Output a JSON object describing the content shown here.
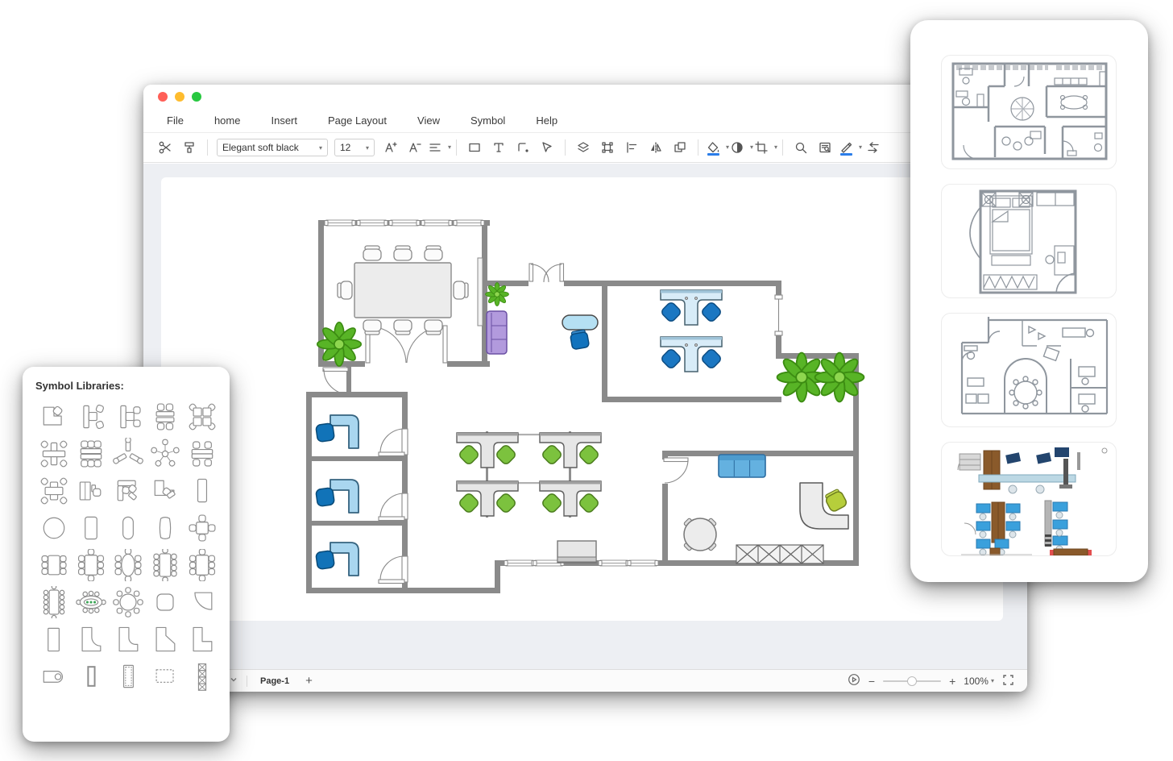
{
  "window": {
    "traffic_lights": {
      "red": "#ff5f57",
      "yellow": "#febc2e",
      "green": "#28c840"
    },
    "menu": [
      "File",
      "home",
      "Insert",
      "Page Layout",
      "View",
      "Symbol",
      "Help"
    ],
    "toolbar": {
      "style_value": "Elegant soft black",
      "size_value": "12",
      "items": [
        {
          "type": "icon",
          "name": "cut-icon"
        },
        {
          "type": "icon",
          "name": "format-painter-icon"
        },
        {
          "type": "sep"
        },
        {
          "type": "select",
          "name": "style-select",
          "bind": "style_value"
        },
        {
          "type": "select",
          "name": "font-size-select",
          "bind": "size_value",
          "narrow": true
        },
        {
          "type": "icon",
          "name": "font-increase-icon"
        },
        {
          "type": "icon",
          "name": "font-decrease-icon"
        },
        {
          "type": "icon",
          "name": "text-align-icon",
          "caret": true
        },
        {
          "type": "sep"
        },
        {
          "type": "icon",
          "name": "shape-rect-icon"
        },
        {
          "type": "icon",
          "name": "text-tool-icon"
        },
        {
          "type": "icon",
          "name": "connector-icon"
        },
        {
          "type": "icon",
          "name": "pointer-icon"
        },
        {
          "type": "sep"
        },
        {
          "type": "icon",
          "name": "layers-icon"
        },
        {
          "type": "icon",
          "name": "group-icon"
        },
        {
          "type": "icon",
          "name": "align-icon"
        },
        {
          "type": "icon",
          "name": "mirror-icon"
        },
        {
          "type": "icon",
          "name": "arrange-icon"
        },
        {
          "type": "sep"
        },
        {
          "type": "icon",
          "name": "fill-color-icon",
          "caret": true,
          "underline": "#2b7de9"
        },
        {
          "type": "icon",
          "name": "contrast-icon",
          "caret": true
        },
        {
          "type": "icon",
          "name": "crop-icon",
          "caret": true
        },
        {
          "type": "sep"
        },
        {
          "type": "icon",
          "name": "search-icon"
        },
        {
          "type": "icon",
          "name": "find-replace-icon"
        },
        {
          "type": "icon",
          "name": "line-color-icon",
          "caret": true,
          "underline": "#2b7de9"
        },
        {
          "type": "icon",
          "name": "swap-arrows-icon"
        }
      ]
    },
    "statusbar": {
      "page_tab": "Page-1",
      "add_label": "+",
      "zoom_out": "−",
      "zoom_in": "+",
      "zoom": "100%"
    }
  },
  "symbol_panel": {
    "title": "Symbol Libraries:",
    "symbols": [
      "corner-workstation",
      "t-workstation-right",
      "t-workstation",
      "double-desk-4-chairs",
      "pinwheel-cluster-4",
      "cross-cluster-4",
      "back-to-back-desks-6",
      "y-cluster-3",
      "star-cluster-5",
      "double-desk-4",
      "cross-table-4",
      "cabinet-workstation",
      "desk-2-chairs",
      "l-workstation",
      "side-table",
      "round-table",
      "rect-table",
      "rounded-table",
      "oval-table",
      "square-table-4",
      "table-6-seats",
      "table-8-seats",
      "oval-table-8-seats",
      "table-10-seats",
      "table-8-seats-b",
      "table-12-seats",
      "conference-table-green",
      "round-table-8-seats",
      "rounded-square-table",
      "quarter-round-table",
      "counter-block",
      "l-counter-rounded",
      "l-counter",
      "l-counter-chamfer",
      "l-counter-b",
      "keyhole-desk",
      "narrow-cabinet",
      "shelving-unit",
      "dashed-region",
      "crossed-shelving"
    ]
  },
  "right_panel": {
    "cards": [
      "house-floor-plan-thumbnail",
      "bedroom-floor-plan-thumbnail",
      "office-floor-plan-thumbnail",
      "colored-office-layout-thumbnail"
    ]
  },
  "canvas": {
    "rooms": [
      "conference-room",
      "lounge",
      "team-office",
      "private-office-1",
      "private-office-2",
      "private-office-3",
      "open-workspace",
      "break-room"
    ]
  },
  "colors": {
    "wall_gray": "#8a8a8a",
    "desk_blue": "#a9d6ef",
    "desk_cyan": "#d8ecf8",
    "chair_blue": "#1273bd",
    "chair_green": "#7cc23e",
    "sofa_purple": "#b29add",
    "sofa_blue": "#64b1e0",
    "reception_chair_green": "#b6ce3b",
    "plant_green": "#58b426",
    "accent_underline": "#2b7de9"
  }
}
